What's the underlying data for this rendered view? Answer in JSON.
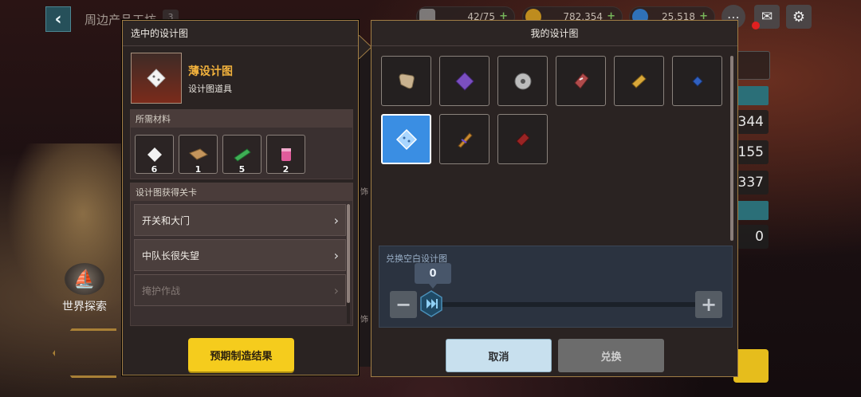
{
  "topbar": {
    "title": "周边产品工坊",
    "badge": "3",
    "resources": [
      {
        "name": "resource-stamina",
        "value": "42/75",
        "color": "#8a8a8a"
      },
      {
        "name": "resource-gold",
        "value": "782,354",
        "color": "#d4a020"
      },
      {
        "name": "resource-gem",
        "value": "25,518",
        "color": "#2a7fd4"
      }
    ]
  },
  "left_panel": {
    "header": "选中的设计图",
    "item_name": "薄设计图",
    "item_type": "设计图道具",
    "materials_title": "所需材料",
    "materials": [
      {
        "icon": "white-diamond-icon",
        "count": "6"
      },
      {
        "icon": "wood-plank-icon",
        "count": "1"
      },
      {
        "icon": "green-cloth-icon",
        "count": "5"
      },
      {
        "icon": "pink-paint-icon",
        "count": "2"
      }
    ],
    "stages_title": "设计图获得关卡",
    "stages": [
      {
        "label": "开关和大门",
        "enabled": true
      },
      {
        "label": "中队长很失望",
        "enabled": true
      },
      {
        "label": "掩护作战",
        "enabled": false
      }
    ],
    "preview_button": "预期制造结果"
  },
  "right_panel": {
    "header": "我的设计图",
    "slots": [
      {
        "icon": "scroll-icon",
        "color": "#c9b28f"
      },
      {
        "icon": "purple-gem-icon",
        "color": "#7b4fc0"
      },
      {
        "icon": "disc-icon",
        "color": "#bcbcbc"
      },
      {
        "icon": "card-icon",
        "color": "#b04b4b"
      },
      {
        "icon": "yellow-tag-icon",
        "color": "#d9a83a"
      },
      {
        "icon": "blue-chip-icon",
        "color": "#3060c0"
      },
      {
        "icon": "blue-diamond-icon",
        "color": "#ffffff",
        "selected": true
      },
      {
        "icon": "feather-icon",
        "color": "#c98a2f"
      },
      {
        "icon": "red-box-icon",
        "color": "#9a2424"
      }
    ],
    "exchange_title": "兑换空白设计图",
    "quantity": "0",
    "cancel_button": "取消",
    "confirm_button": "兑换"
  },
  "background": {
    "world_label": "世界探索",
    "side_values": [
      "344",
      "155",
      "337",
      "0"
    ],
    "side_labels": [
      "饰",
      "饰"
    ]
  }
}
